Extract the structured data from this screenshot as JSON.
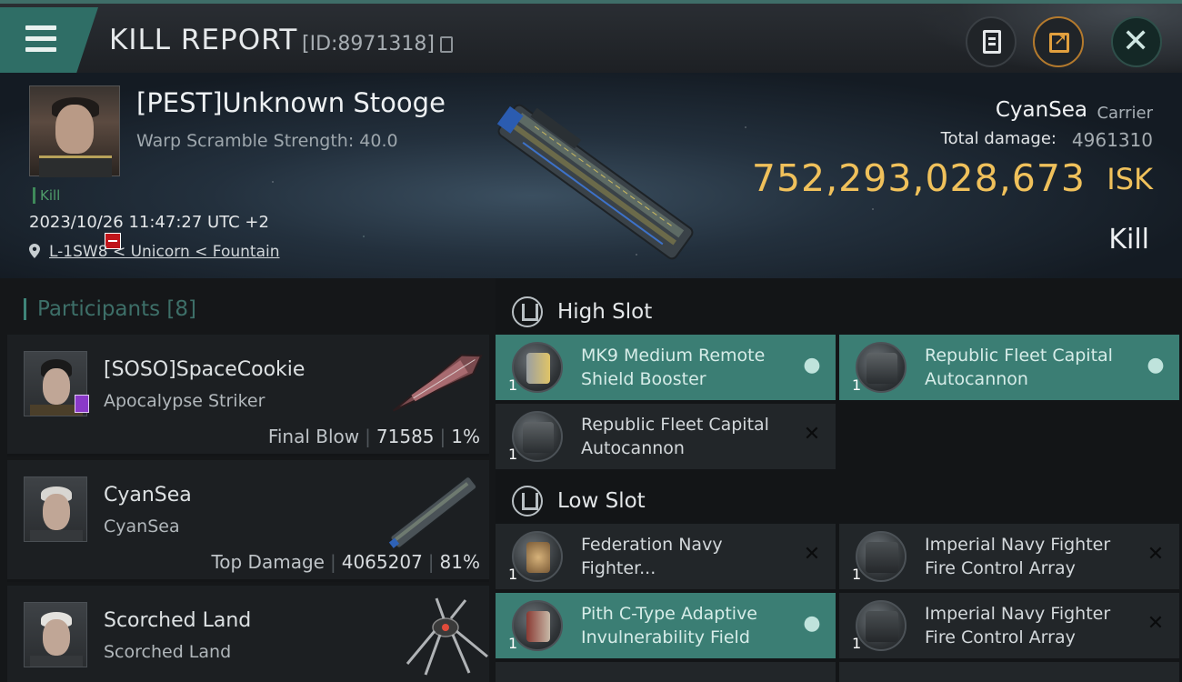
{
  "header": {
    "title": "KILL REPORT",
    "report_id": "[ID:8971318]"
  },
  "victim": {
    "name": "[PEST]Unknown Stooge",
    "warp_scramble": "Warp Scramble Strength: 40.0",
    "kill_tag": "Kill",
    "timestamp": "2023/10/26 11:47:27 UTC +2",
    "location": "L-1SW8 < Unicorn < Fountain"
  },
  "summary": {
    "top_attacker": "CyanSea",
    "top_attacker_ship": "Carrier",
    "total_damage_label": "Total damage:",
    "total_damage_value": "4961310",
    "isk_value": "752,293,028,673",
    "isk_unit": "ISK",
    "result": "Kill"
  },
  "participants": {
    "label": "Participants",
    "count": "[8]",
    "items": [
      {
        "name": "[SOSO]SpaceCookie",
        "ship": "Apocalypse Striker",
        "role": "Final Blow",
        "damage": "71585",
        "percent": "1%"
      },
      {
        "name": "CyanSea",
        "ship": "CyanSea",
        "role": "Top Damage",
        "damage": "4065207",
        "percent": "81%"
      },
      {
        "name": "Scorched Land",
        "ship": "Scorched Land"
      }
    ]
  },
  "fitting": {
    "high_slot_label": "High Slot",
    "low_slot_label": "Low Slot",
    "high_slot": [
      {
        "qty": "1",
        "name": "MK9 Medium Remote Shield Booster",
        "status": "fitted",
        "status_icon": "user-icon"
      },
      {
        "qty": "1",
        "name": "Republic Fleet Capital Autocannon",
        "status": "fitted",
        "status_icon": "user-icon"
      },
      {
        "qty": "1",
        "name": "Republic Fleet Capital Autocannon",
        "status": "destroyed",
        "status_icon": "close-icon"
      }
    ],
    "low_slot": [
      {
        "qty": "1",
        "name": "Federation Navy Fighter...",
        "status": "destroyed",
        "status_icon": "close-icon"
      },
      {
        "qty": "1",
        "name": "Imperial Navy Fighter Fire Control Array",
        "status": "destroyed",
        "status_icon": "close-icon"
      },
      {
        "qty": "1",
        "name": "Pith C-Type Adaptive Invulnerability Field",
        "status": "fitted",
        "status_icon": "user-icon"
      },
      {
        "qty": "1",
        "name": "Imperial Navy Fighter Fire Control Array",
        "status": "destroyed",
        "status_icon": "close-icon"
      }
    ]
  },
  "colors": {
    "accent_teal": "#3b7e74",
    "isk_gold": "#f0c15b",
    "kill_green": "#4f9c6a"
  }
}
